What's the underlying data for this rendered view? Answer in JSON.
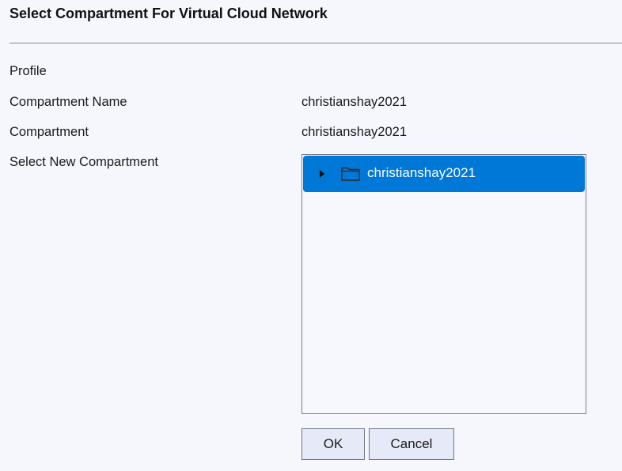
{
  "dialog": {
    "title": "Select Compartment For Virtual Cloud Network"
  },
  "fields": {
    "profile_label": "Profile",
    "profile_value": "",
    "compartment_name_label": "Compartment Name",
    "compartment_name_value": "christianshay2021",
    "compartment_label": "Compartment",
    "compartment_value": "christianshay2021",
    "select_new_label": "Select New Compartment"
  },
  "tree": {
    "items": [
      {
        "label": "christianshay2021",
        "icon": "folder-icon",
        "expanded": false,
        "selected": true
      }
    ],
    "selected_color": "#0078d7"
  },
  "buttons": {
    "ok_label": "OK",
    "cancel_label": "Cancel"
  }
}
